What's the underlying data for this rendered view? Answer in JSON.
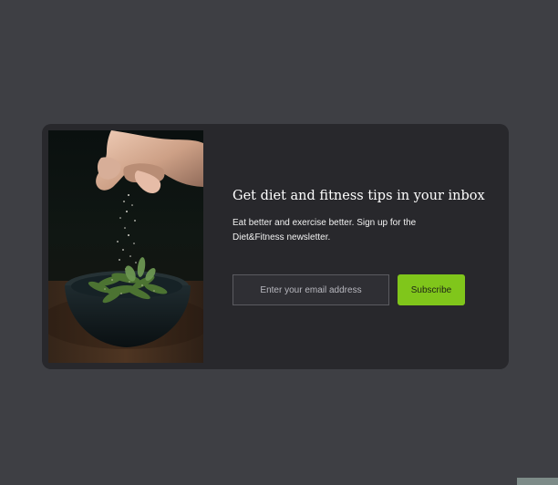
{
  "newsletter": {
    "headline": "Get diet and fitness tips in your inbox",
    "description": "Eat better and exercise better. Sign up for the Diet&Fitness newsletter.",
    "email_placeholder": "Enter your email address",
    "subscribe_label": "Subscribe",
    "image_icon": "salad-bowl-photo"
  },
  "colors": {
    "page_background": "#3e3f44",
    "card_background": "#28282c",
    "accent": "#80c61b",
    "input_border": "#5b5b60"
  }
}
